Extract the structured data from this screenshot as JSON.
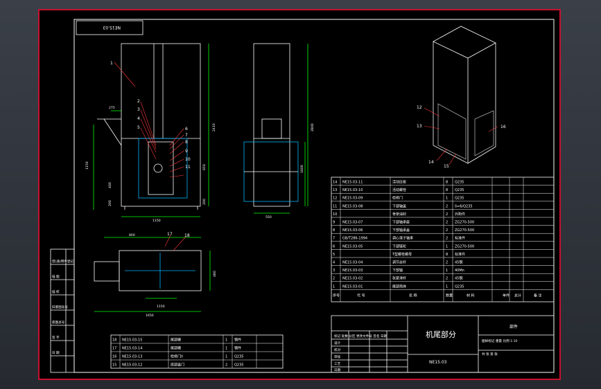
{
  "sheet": {
    "drawing_no_rotated": "NE15.03"
  },
  "left_strip": [
    "借(通)用件登记",
    "描 图",
    "描 校",
    "旧底图总号",
    "底图总号",
    "签 字",
    "日 期"
  ],
  "front_view": {
    "callouts": [
      "1",
      "2",
      "3",
      "4",
      "5",
      "6",
      "7",
      "8",
      "9",
      "10",
      "11"
    ],
    "dims": [
      "275",
      "1150",
      "1150",
      "2410",
      "400",
      "200",
      "650",
      "200"
    ]
  },
  "side_view": {
    "dims": [
      "550",
      "2800",
      "1600"
    ]
  },
  "plan_view": {
    "callouts": [
      "17",
      "18"
    ],
    "dims": [
      "800",
      "1150",
      "1650",
      "480"
    ]
  },
  "iso_view": {
    "callouts": [
      "12",
      "13",
      "14",
      "15",
      "16"
    ]
  },
  "parts_list": {
    "header": [
      "序号",
      "代 号",
      "名 称",
      "数量",
      "材 料",
      "单件",
      "总计",
      "备 注"
    ],
    "rows": [
      [
        "14",
        "NE15.03-11",
        "活动压板",
        "8",
        "Q235"
      ],
      [
        "13",
        "NE15.03-10",
        "活动螺栓",
        "8",
        "Q235"
      ],
      [
        "12",
        "NE15.03-09",
        "检修门",
        "1",
        "Q235"
      ],
      [
        "11",
        "NE15.03-08",
        "下部轴盖",
        "2",
        "δ=6/Q235"
      ],
      [
        "10",
        "",
        "骨架油封",
        "2",
        "外购件"
      ],
      [
        "9",
        "NE15.03-07",
        "下部轴承座",
        "2",
        "ZG270-500"
      ],
      [
        "8",
        "NE15.03-06",
        "下部轴承盖",
        "2",
        "ZG270-500"
      ],
      [
        "7",
        "GB/T286-1994",
        "调心滚子轴承",
        "2",
        "标准件"
      ],
      [
        "6",
        "NE15.03-05",
        "下部链轮",
        "1",
        "ZG270-500"
      ],
      [
        "5",
        "",
        "T型螺栓螺母",
        "8",
        "标准件"
      ],
      [
        "4",
        "NE15.03-04",
        "调节丝杆",
        "2",
        "45钢"
      ],
      [
        "3",
        "NE15.03-03",
        "下部轴",
        "1",
        "40Mn"
      ],
      [
        "2",
        "NE15.03-02",
        "张紧滑杆",
        "2",
        "45钢"
      ],
      [
        "1",
        "NE15.03-01",
        "尾部壳体",
        "1",
        "Q235"
      ]
    ]
  },
  "parts_list_lower": {
    "rows": [
      [
        "18",
        "NE15.03-15",
        "尾部栅",
        "1",
        "钢件"
      ],
      [
        "17",
        "NE15.03-14",
        "尾部栅",
        "1",
        "钢件"
      ],
      [
        "16",
        "NE15.03-13",
        "检修门II",
        "1",
        "Q235"
      ],
      [
        "15",
        "NE15.03-12",
        "底部盖门",
        "2",
        "Q235"
      ]
    ]
  },
  "title_block": {
    "title": "机尾部分",
    "drawing_no": "NE15.03",
    "category": "部件",
    "rows": [
      "标记 处数 分区 更改文件号 签名 日期",
      "设计",
      "校对",
      "审核",
      "工艺",
      "日期"
    ],
    "right_rows": [
      "图样标记 重量 比例  1:10",
      "共 张 第 张"
    ]
  }
}
